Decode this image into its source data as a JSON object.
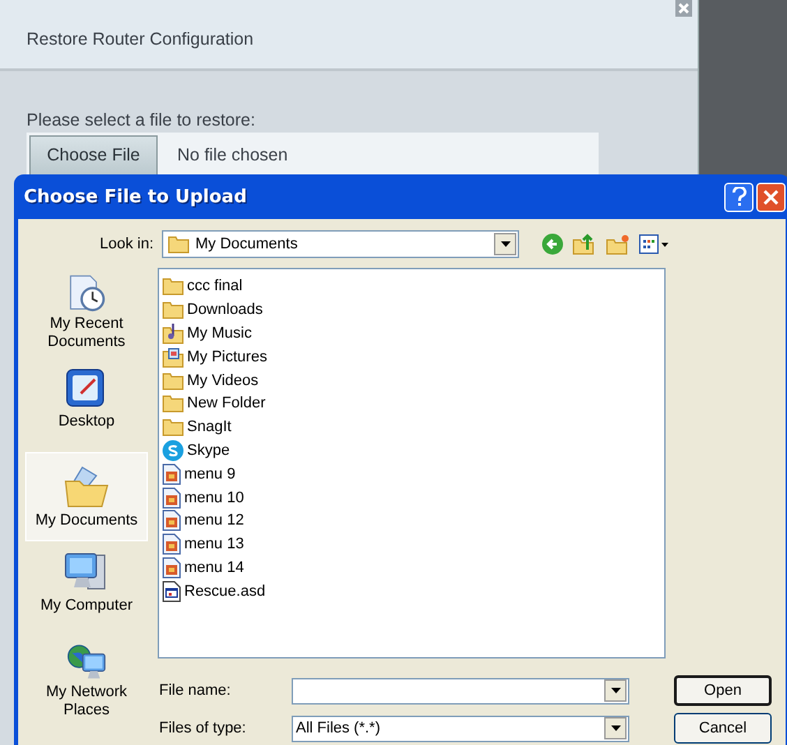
{
  "page": {
    "dialog_title": "Restore Router Configuration",
    "prompt": "Please select a file to restore:",
    "choose_button": "Choose File",
    "file_status": "No file chosen"
  },
  "file_dialog": {
    "title": "Choose File to Upload",
    "look_in_label": "Look in:",
    "look_in_value": "My Documents",
    "places": [
      {
        "label": "My Recent Documents",
        "kind": "recent",
        "selected": false
      },
      {
        "label": "Desktop",
        "kind": "desktop",
        "selected": false
      },
      {
        "label": "My Documents",
        "kind": "documents",
        "selected": true
      },
      {
        "label": "My Computer",
        "kind": "computer",
        "selected": false
      },
      {
        "label": "My Network Places",
        "kind": "network",
        "selected": false
      }
    ],
    "files": [
      {
        "name": "ccc final",
        "kind": "folder"
      },
      {
        "name": "Downloads",
        "kind": "folder"
      },
      {
        "name": "My Music",
        "kind": "music"
      },
      {
        "name": "My Pictures",
        "kind": "pictures"
      },
      {
        "name": "My Videos",
        "kind": "folder"
      },
      {
        "name": "New Folder",
        "kind": "folder"
      },
      {
        "name": "SnagIt",
        "kind": "folder"
      },
      {
        "name": "Skype",
        "kind": "skype"
      },
      {
        "name": "menu 9",
        "kind": "image"
      },
      {
        "name": "menu 10",
        "kind": "image"
      },
      {
        "name": "menu 12",
        "kind": "image"
      },
      {
        "name": "menu 13",
        "kind": "image"
      },
      {
        "name": "menu 14",
        "kind": "image"
      },
      {
        "name": "Rescue.asd",
        "kind": "app"
      }
    ],
    "file_name_label": "File name:",
    "file_type_label": "Files of type:",
    "file_type_value": "All Files (*.*)",
    "buttons": [
      {
        "label": "Open",
        "default": true
      },
      {
        "label": "Cancel",
        "default": false
      }
    ]
  }
}
